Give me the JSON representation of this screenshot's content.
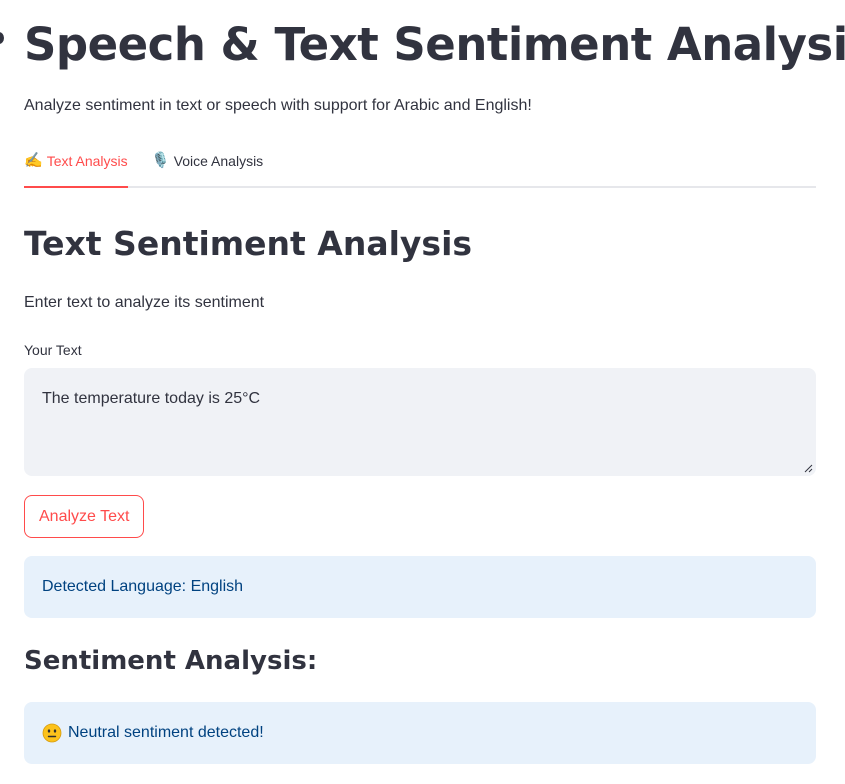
{
  "header": {
    "title": "Speech & Text Sentiment Analysis",
    "subtitle": "Analyze sentiment in text or speech with support for Arabic and English!"
  },
  "tabs": [
    {
      "icon": "✍️",
      "icon_name": "writing-hand-icon",
      "label": "Text Analysis",
      "active": true
    },
    {
      "icon": "🎙️",
      "icon_name": "microphone-icon",
      "label": "Voice Analysis",
      "active": false
    }
  ],
  "text_section": {
    "title": "Text Sentiment Analysis",
    "description": "Enter text to analyze its sentiment",
    "input_label": "Your Text",
    "input_value": "The temperature today is 25°C",
    "analyze_button_label": "Analyze Text"
  },
  "results": {
    "language_message": "Detected Language: English",
    "title": "Sentiment Analysis:",
    "sentiment_icon": "neutral-face-icon",
    "sentiment_message": "Neutral sentiment detected!"
  },
  "colors": {
    "accent": "#ff4b4b",
    "text": "#31333f",
    "info_background": "#e7f1fb",
    "info_text": "#004280",
    "input_background": "#f0f2f6"
  }
}
